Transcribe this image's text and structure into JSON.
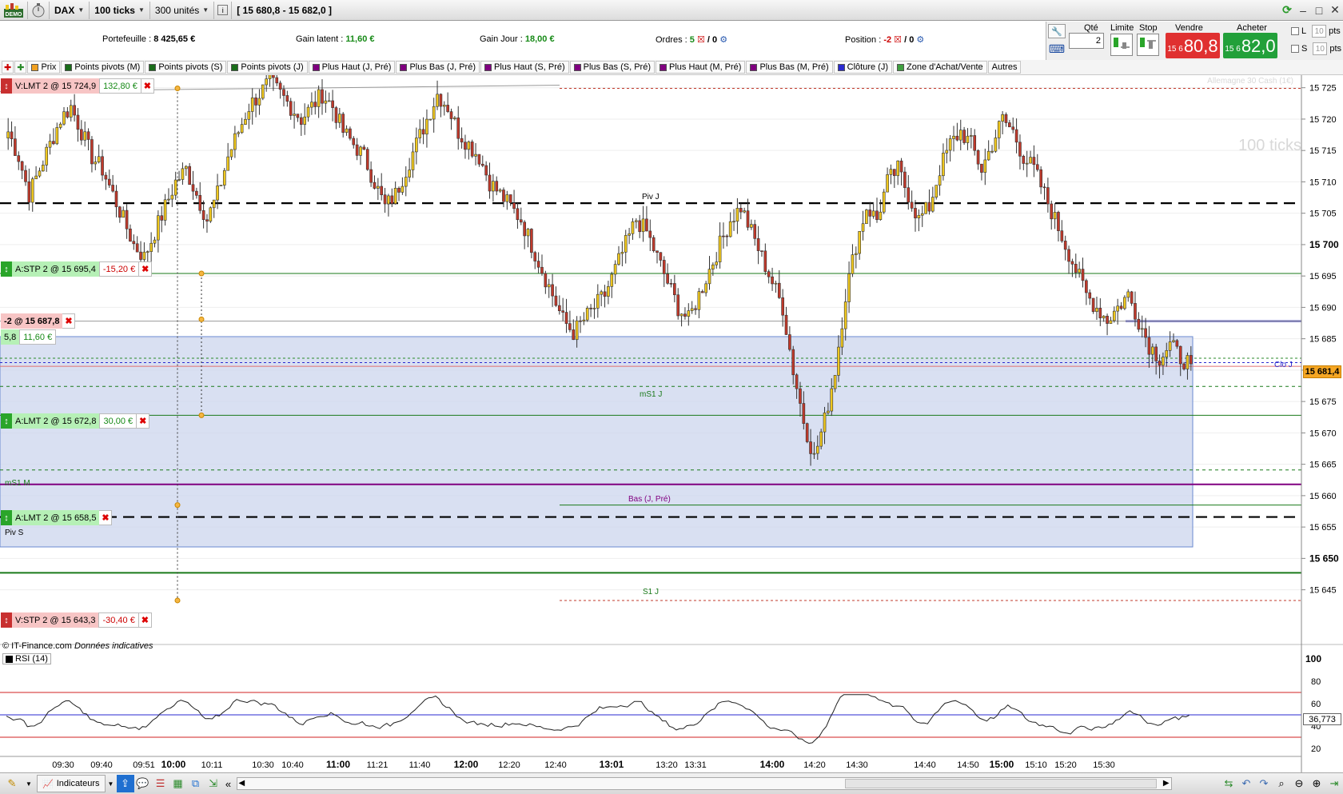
{
  "toolbar": {
    "demo_label": "DEMO",
    "instrument": "DAX",
    "period": "100 ticks",
    "units": "300 unités",
    "range": "[ 15 680,8 - 15 682,0 ]"
  },
  "info": {
    "portefeuille_label": "Portefeuille :",
    "portefeuille_value": "8 425,65 €",
    "gain_latent_label": "Gain latent :",
    "gain_latent_value": "11,60 €",
    "gain_jour_label": "Gain Jour :",
    "gain_jour_value": "18,00 €",
    "ordres_label": "Ordres :",
    "ordres_value": "5",
    "ordres_sep": "/ 0",
    "position_label": "Position :",
    "position_value": "-2",
    "position_sep": "/ 0"
  },
  "order_panel": {
    "qty_label": "Qté",
    "qty_value": "2",
    "limit_label": "Limite",
    "stop_label": "Stop",
    "sell_label": "Vendre",
    "sell_small": "15 6",
    "sell_big": "80,8",
    "buy_label": "Acheter",
    "buy_small": "15 6",
    "buy_big": "82,0",
    "l_label": "L",
    "s_label": "S",
    "pts_value": "10",
    "pts_label": "pts"
  },
  "filters": [
    "Prix",
    "Points pivots (M)",
    "Points pivots (S)",
    "Points pivots (J)",
    "Plus Haut (J, Pré)",
    "Plus Bas (J, Pré)",
    "Plus Haut (S, Pré)",
    "Plus Bas (S, Pré)",
    "Plus Haut (M, Pré)",
    "Plus Bas (M, Pré)",
    "Clôture (J)",
    "Zone d'Achat/Vente",
    "Autres"
  ],
  "filter_colors": [
    "#f0a020",
    "#1a6d1a",
    "#1a6d1a",
    "#1a6d1a",
    "#800080",
    "#800080",
    "#800080",
    "#800080",
    "#800080",
    "#800080",
    "#2a2ad0",
    "#40a040",
    ""
  ],
  "watermark": {
    "title": "100 ticks",
    "subtitle": "Allemagne 30 Cash (1€)"
  },
  "orders": [
    {
      "text": "V:LMT  2 @ 15 724,9",
      "amount": "132,80 €",
      "color": "red"
    },
    {
      "text": "A:STP  2 @ 15 695,4",
      "amount": "-15,20 €",
      "color": "green"
    },
    {
      "text": "A:LMT  2 @ 15 672,8",
      "amount": "30,00 €",
      "color": "green"
    },
    {
      "text": "A:LMT  2 @ 15 658,5",
      "amount": "",
      "color": "green"
    },
    {
      "text": "V:STP  2 @ 15 643,3",
      "amount": "-30,40 €",
      "color": "red"
    }
  ],
  "position": {
    "text": "-2 @ 15 687,8",
    "qty": "5,8",
    "gain": "11,60 €"
  },
  "chart_labels": {
    "piv_j": "Piv J",
    "ms1_j": "mS1 J",
    "ms1_m": "mS1 M",
    "bas_j_pre": "Bas (J, Pré)",
    "piv_s": "Piv S",
    "s1_j": "S1 J",
    "clo_j": "Clo J",
    "copyright": "© IT-Finance.com",
    "indicatives": "Données indicatives"
  },
  "price_axis": [
    "15 725",
    "15 720",
    "15 715",
    "15 710",
    "15 705",
    "15 700",
    "15 695",
    "15 690",
    "15 685",
    "15 680",
    "15 675",
    "15 670",
    "15 665",
    "15 660",
    "15 655",
    "15 650",
    "15 645"
  ],
  "price_axis_bold": [
    "15 700",
    "15 650"
  ],
  "current_price": "15 681,4",
  "rsi": {
    "label": "RSI (14)",
    "value": "36,773",
    "ticks": [
      "100",
      "80",
      "60",
      "40",
      "20"
    ]
  },
  "time_axis": [
    "09:30",
    "09:40",
    "09:51",
    "10:00",
    "10:11",
    "10:30",
    "10:40",
    "11:00",
    "11:21",
    "11:40",
    "12:00",
    "12:20",
    "12:40",
    "13:01",
    "13:20",
    "13:31",
    "14:00",
    "14:20",
    "14:30",
    "14:40",
    "14:50",
    "15:00",
    "15:10",
    "15:20",
    "15:30"
  ],
  "time_axis_bold": [
    "10:00",
    "11:00",
    "12:00",
    "13:01",
    "14:00",
    "15:00"
  ],
  "bottom": {
    "indicators_label": "Indicateurs"
  },
  "colors": {
    "sell": "#e03030",
    "buy": "#22a03a",
    "zone": "#ccd6ee",
    "candle_up": "#f0c81e",
    "candle_down": "#c0392b"
  },
  "chart_data": {
    "type": "candlestick",
    "y_range": [
      15641,
      15727
    ],
    "close_series_approx": [
      15718,
      15714,
      15708,
      15712,
      15716,
      15720,
      15722,
      15718,
      15714,
      15712,
      15708,
      15704,
      15700,
      15698,
      15702,
      15706,
      15710,
      15712,
      15708,
      15704,
      15708,
      15714,
      15718,
      15722,
      15724,
      15726,
      15724,
      15722,
      15720,
      15722,
      15724,
      15722,
      15718,
      15716,
      15714,
      15710,
      15706,
      15708,
      15712,
      15716,
      15720,
      15724,
      15722,
      15718,
      15716,
      15714,
      15710,
      15708,
      15706,
      15704,
      15700,
      15696,
      15692,
      15688,
      15686,
      15688,
      15690,
      15692,
      15696,
      15700,
      15704,
      15702,
      15698,
      15694,
      15690,
      15688,
      15692,
      15696,
      15700,
      15704,
      15706,
      15702,
      15698,
      15694,
      15690,
      15680,
      15672,
      15666,
      15672,
      15680,
      15692,
      15700,
      15706,
      15704,
      15710,
      15712,
      15708,
      15704,
      15706,
      15712,
      15716,
      15718,
      15716,
      15712,
      15716,
      15720,
      15718,
      15714,
      15712,
      15708,
      15704,
      15700,
      15696,
      15692,
      15690,
      15688,
      15690,
      15692,
      15688,
      15684,
      15682,
      15684,
      15682,
      15681
    ]
  }
}
